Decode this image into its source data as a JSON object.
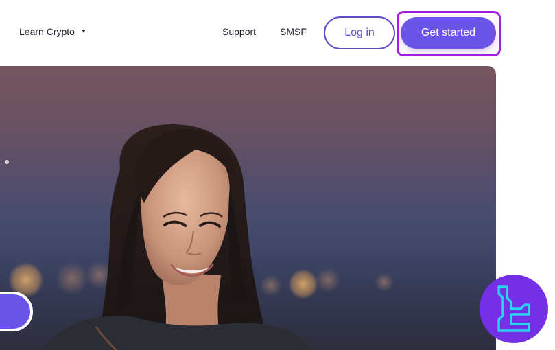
{
  "header": {
    "nav": {
      "learn_crypto": "Learn Crypto",
      "support": "Support",
      "smsf": "SMSF"
    },
    "login_label": "Log in",
    "get_started_label": "Get started"
  },
  "colors": {
    "brand_purple": "#6a55e8",
    "highlight_outline": "#a41ee0",
    "badge_purple": "#7430e6",
    "badge_logo_cyan": "#29d3f0"
  },
  "icons": {
    "dropdown": "caret-down-icon",
    "badge_logo": "tc-logo-icon"
  }
}
